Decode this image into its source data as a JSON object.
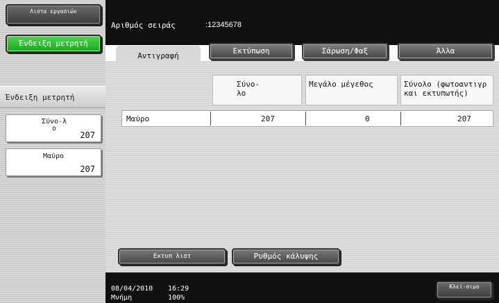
{
  "left_panel": {
    "job_list_button": "Λιστα εργασιών",
    "counter_button": "Ένδειξη μετρητή",
    "section_header": "Ένδειξη μετρητή",
    "cards": [
      {
        "label": "Σύνο-λο",
        "value": "207"
      },
      {
        "label": "Μαύρο",
        "value": "207"
      }
    ]
  },
  "header": {
    "serial_label": "Αριθμός σειράς",
    "serial_value": ":12345678",
    "tabs": [
      "Αντιγραφή",
      "Εκτύπωση",
      "Σάρωση/Φαξ",
      "Άλλα"
    ],
    "active_tab": "Αντιγραφή"
  },
  "table": {
    "columns": [
      "Σύνο-λο",
      "Μεγάλο μέγεθος",
      "Σύνολο (φωτοαντιγρ και εκτυπωτής)"
    ],
    "rows": [
      {
        "label": "Μαύρο",
        "values": [
          "207",
          "0",
          "207"
        ]
      }
    ]
  },
  "buttons": {
    "print_list": "Εκτυπ λιστ",
    "coverage_setting": "Ρυθμός κάλυψης"
  },
  "status": {
    "date": "08/04/2010",
    "time": "16:29",
    "memory_label": "Μνήμη",
    "memory_value": "100%"
  },
  "close_button": "Κλεί-σιμο"
}
